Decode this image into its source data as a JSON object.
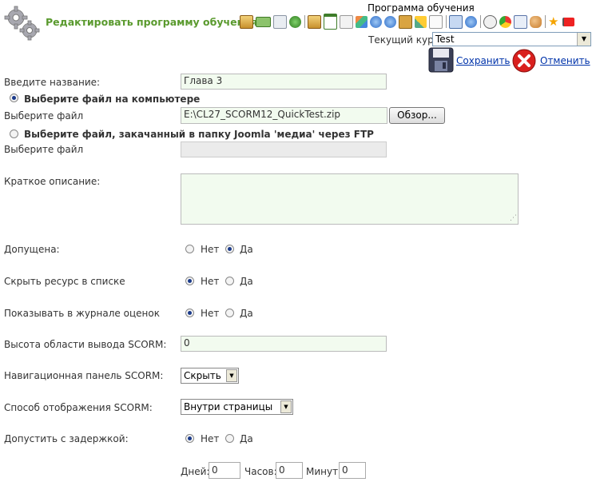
{
  "header": {
    "page_title": "Редактировать программу обучения",
    "program_title": "Программа обучения",
    "course_label": "Текущий курс",
    "course_value": "Test",
    "save_label": "Сохранить",
    "cancel_label": "Отменить",
    "toolbar_icons": [
      "home-icon",
      "money-icon",
      "copy-icon",
      "globe-icon",
      "home-icon",
      "calendar-icon",
      "pages-icon",
      "tags-icon",
      "help-icon",
      "info-icon",
      "lock-icon",
      "pencil-icon",
      "edit-icon",
      "chat-icon",
      "globe-icon",
      "search-icon",
      "chart-icon",
      "mail-icon",
      "users-icon",
      "star-icon",
      "flag-icon"
    ]
  },
  "form": {
    "name_label": "Введите название:",
    "name_value": "Глава 3",
    "choose_local_label": "Выберите файл на компьютере",
    "choose_file_label": "Выберите файл",
    "file_path_value": "E:\\CL27_SCORM12_QuickTest.zip",
    "browse_label": "Обзор...",
    "choose_ftp_label": "Выберите файл, закачанный в папку Joomla 'медиа' через FTP",
    "choose_file2_label": "Выберите файл",
    "short_desc_label": "Краткое описание:",
    "published_label": "Допущена:",
    "hide_label": "Скрыть ресурс в списке",
    "gradebook_label": "Показывать в журнале оценок",
    "height_label": "Высота области вывода SCORM:",
    "height_value": "0",
    "nav_label": "Навигационная панель SCORM:",
    "nav_value": "Скрыть",
    "display_label": "Способ отображения SCORM:",
    "display_value": "Внутри страницы",
    "delay_label": "Допустить с задержкой:",
    "no_label": "Нет",
    "yes_label": "Да",
    "days_label": "Дней:",
    "days_value": "0",
    "hours_label": "Часов:",
    "hours_value": "0",
    "minutes_label": "Минут:",
    "minutes_value": "0"
  },
  "state": {
    "file_source": "local",
    "published": "yes",
    "hide": "no",
    "gradebook": "no",
    "delay": "no"
  }
}
